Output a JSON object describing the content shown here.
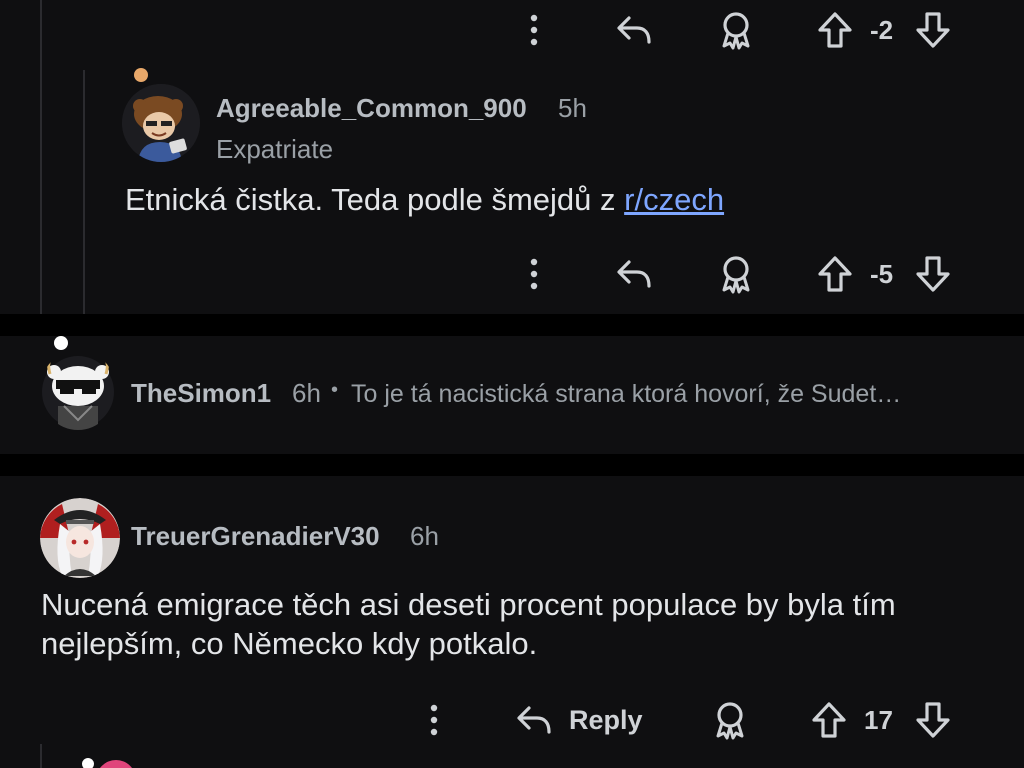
{
  "comments": [
    {
      "username": "",
      "vote_count": "-2"
    },
    {
      "username": "Agreeable_Common_900",
      "time": "5h",
      "flair": "Expatriate",
      "body_prefix": "Etnická čistka. Teda podle šmejdů z ",
      "body_link": "r/czech",
      "vote_count": "-5"
    },
    {
      "username": "TheSimon1",
      "time": "6h",
      "separator": "•",
      "preview": "To je tá nacistická strana ktorá hovorí, že Sudet…"
    },
    {
      "username": "TreuerGrenadierV30",
      "time": "6h",
      "body": "Nucená emigrace těch asi deseti procent populace by byla tím nejlepším, co Německo kdy potkalo.",
      "reply_label": "Reply",
      "vote_count": "17"
    }
  ],
  "colors": {
    "background": "#000000",
    "card": "#0f0f11",
    "link": "#7ea6ff",
    "text_muted": "#9aa0a6"
  },
  "icons": [
    "more-vertical-icon",
    "reply-arrow-icon",
    "award-icon",
    "upvote-arrow-icon",
    "downvote-arrow-icon"
  ]
}
